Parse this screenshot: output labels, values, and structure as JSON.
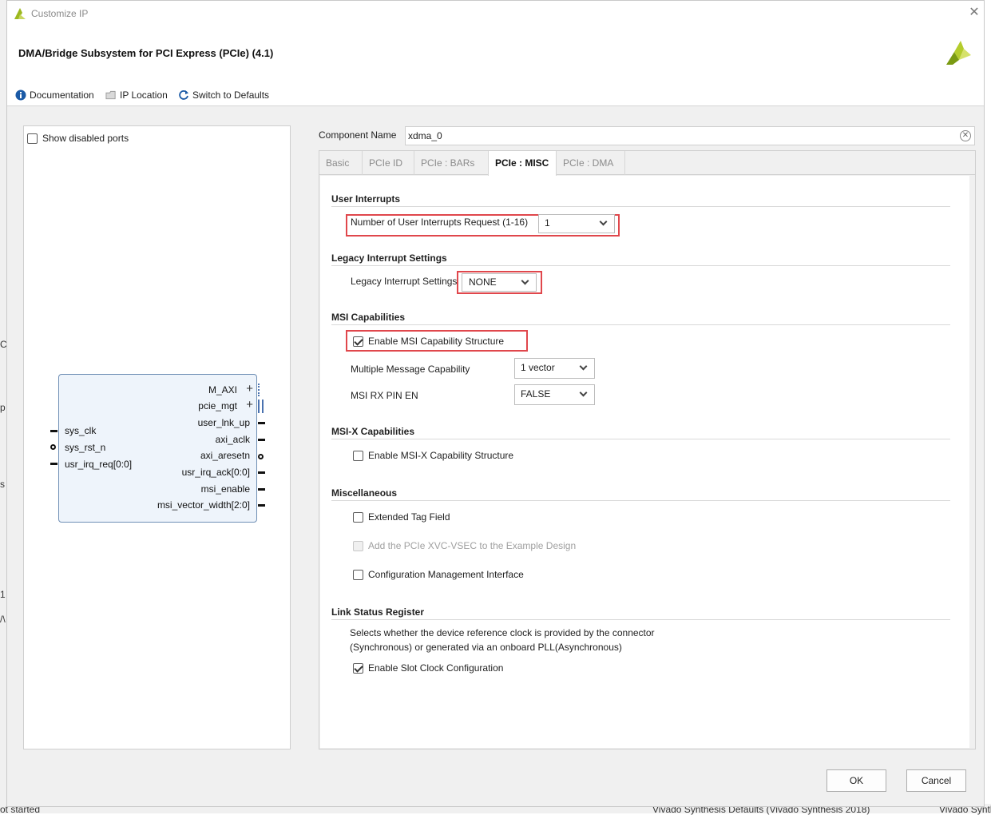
{
  "background": {
    "left_text_1": "p",
    "left_text_2": "s",
    "left_text_3": "1",
    "left_text_4": "/\\",
    "left_text_5": "C",
    "bottom_left": "ot started",
    "bottom_middle": "Vivado Synthesis Defaults (Vivado Synthesis 2018)",
    "bottom_right": "Vivado Synth"
  },
  "dialog": {
    "title": "Customize IP",
    "close_symbol": "✕"
  },
  "header": {
    "ip_name": "DMA/Bridge Subsystem for PCI Express (PCIe) (4.1)"
  },
  "toolbar": {
    "documentation": "Documentation",
    "ip_location": "IP Location",
    "switch_defaults": "Switch to Defaults"
  },
  "left_panel": {
    "show_disabled_ports": "Show disabled ports",
    "block": {
      "right_ports": [
        "M_AXI",
        "pcie_mgt",
        "user_lnk_up",
        "axi_aclk",
        "axi_aresetn",
        "usr_irq_ack[0:0]",
        "msi_enable",
        "msi_vector_width[2:0]"
      ],
      "left_ports": [
        "sys_clk",
        "sys_rst_n",
        "usr_irq_req[0:0]"
      ]
    }
  },
  "component": {
    "label": "Component Name",
    "value": "xdma_0"
  },
  "tabs": [
    "Basic",
    "PCIe ID",
    "PCIe : BARs",
    "PCIe : MISC",
    "PCIe : DMA"
  ],
  "active_tab": "PCIe : MISC",
  "content": {
    "user_interrupts": {
      "heading": "User Interrupts",
      "label": "Number of User Interrupts Request (1-16)",
      "value": "1"
    },
    "legacy": {
      "heading": "Legacy Interrupt Settings",
      "label": "Legacy Interrupt Settings",
      "value": "NONE"
    },
    "msi": {
      "heading": "MSI Capabilities",
      "enable_label": "Enable MSI Capability Structure",
      "enable_checked": true,
      "multi_label": "Multiple Message Capability",
      "multi_value": "1 vector",
      "rx_label": "MSI RX PIN EN",
      "rx_value": "FALSE"
    },
    "msix": {
      "heading": "MSI-X Capabilities",
      "enable_label": "Enable MSI-X Capability Structure",
      "enable_checked": false
    },
    "misc": {
      "heading": "Miscellaneous",
      "ext_tag": "Extended Tag Field",
      "xvc_vsec": "Add the PCIe XVC-VSEC to the Example Design",
      "cfg_mgmt": "Configuration Management Interface"
    },
    "link_status": {
      "heading": "Link Status Register",
      "desc_line1": "Selects whether the device reference clock is provided by the connector",
      "desc_line2": "(Synchronous) or generated via an onboard PLL(Asynchronous)",
      "slot_clock": "Enable Slot Clock Configuration",
      "slot_clock_checked": true
    }
  },
  "buttons": {
    "ok": "OK",
    "cancel": "Cancel"
  },
  "colors": {
    "highlight": "#e0474c",
    "block_fill": "#eef4fb",
    "block_border": "#6f8fb5",
    "brand_green": "#9cb81f"
  }
}
